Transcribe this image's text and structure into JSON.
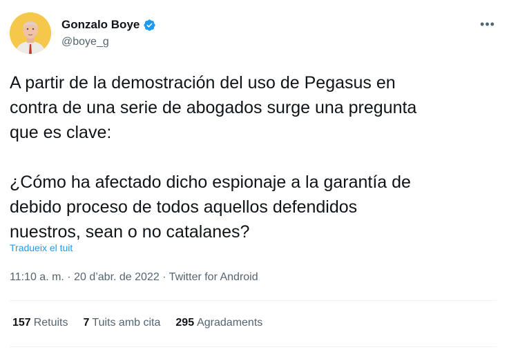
{
  "author": {
    "display_name": "Gonzalo Boye",
    "handle": "@boye_g",
    "verified": true
  },
  "tweet": {
    "text": "A partir de la demostración del uso de Pegasus en\ncontra de una serie de abogados surge una pregunta\nque es clave:\n\n¿Cómo ha afectado dicho espionaje a la garantía de\ndebido proceso de todos aquellos defendidos\nnuestros, sean o no catalanes?",
    "translate_link": "Tradueix el tuit",
    "timestamp": "11:10 a. m. · 20 d’abr. de 2022 · Twitter for Android"
  },
  "stats": {
    "retweets_count": "157",
    "retweets_label": "Retuits",
    "quotes_count": "7",
    "quotes_label": "Tuits amb cita",
    "likes_count": "295",
    "likes_label": "Agradaments"
  },
  "icons": {
    "more": "more-options-icon",
    "verified": "verified-badge-icon"
  },
  "colors": {
    "link": "#1d9bf0",
    "secondary_text": "#536471",
    "avatar_bg": "#f5c84c"
  }
}
